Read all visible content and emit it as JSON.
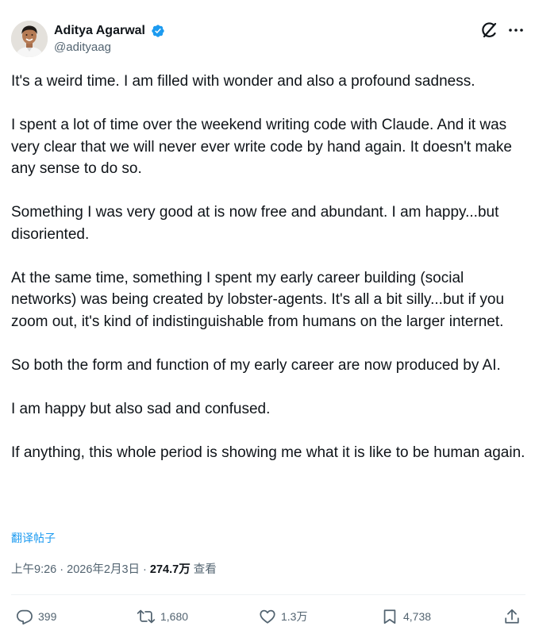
{
  "author": {
    "display_name": "Aditya Agarwal",
    "handle": "@adityaag",
    "verified": true
  },
  "icons": {
    "avatar": "avatar-photo",
    "verified": "verified-badge-icon",
    "grok": "grok-icon",
    "more": "more-icon",
    "reply": "reply-icon",
    "repost": "repost-icon",
    "like": "like-icon",
    "bookmark": "bookmark-icon",
    "share": "share-icon"
  },
  "colors": {
    "accent": "#1d9bf0",
    "text": "#0f1419",
    "secondary": "#536471",
    "divider": "#eff3f4"
  },
  "post": {
    "paragraphs": [
      "It's a weird time. I am filled with wonder and also a profound sadness.",
      "I spent a lot of time over the weekend writing code with Claude. And it was very clear that we will never ever write code by hand again. It doesn't make any sense to do so.",
      "Something I was very good at is now free and abundant. I am happy...but disoriented.",
      "At the same time, something I spent my early career building (social networks) was being created by lobster-agents. It's all a bit silly...but if you zoom out, it's kind of indistinguishable from humans on the larger internet.",
      "So both the form and function of my early career are now produced by AI.",
      "I am happy but also sad and confused.",
      "If anything, this whole period is showing me what it is like to be human again."
    ],
    "translate_label": "翻译帖子",
    "time": "上午9:26",
    "separator": " · ",
    "date": "2026年2月3日",
    "views_count": "274.7万",
    "views_label": "查看"
  },
  "actions": {
    "replies": "399",
    "reposts": "1,680",
    "likes": "1.3万",
    "bookmarks": "4,738"
  }
}
